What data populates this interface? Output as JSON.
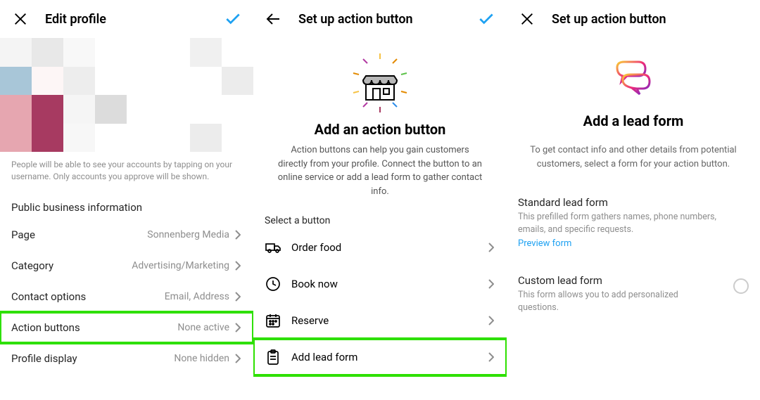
{
  "screen1": {
    "title": "Edit profile",
    "caption": "People will be able to see your accounts by tapping on your username. Only accounts you approve will be shown.",
    "section": "Public business information",
    "rows": {
      "page": {
        "label": "Page",
        "value": "Sonnenberg Media"
      },
      "category": {
        "label": "Category",
        "value": "Advertising/Marketing"
      },
      "contact": {
        "label": "Contact options",
        "value": "Email, Address"
      },
      "action": {
        "label": "Action buttons",
        "value": "None active"
      },
      "profile": {
        "label": "Profile display",
        "value": "None hidden"
      }
    }
  },
  "screen2": {
    "title": "Set up action button",
    "hero_title": "Add an action button",
    "hero_sub": "Action buttons can help you gain customers directly from your profile. Connect the button to an online service or add a lead form to gather contact info.",
    "list_label": "Select a button",
    "buttons": {
      "order": "Order food",
      "book": "Book now",
      "reserve": "Reserve",
      "lead": "Add lead form"
    }
  },
  "screen3": {
    "title": "Set up action button",
    "hero_title": "Add a lead form",
    "hero_sub": "To get contact info and other details from potential customers, select a form for your action button.",
    "standard": {
      "title": "Standard lead form",
      "desc": "This prefilled form gathers names, phone numbers, emails, and specific requests.",
      "preview": "Preview form"
    },
    "custom": {
      "title": "Custom lead form",
      "desc": "This form allows you to add personalized questions."
    }
  }
}
